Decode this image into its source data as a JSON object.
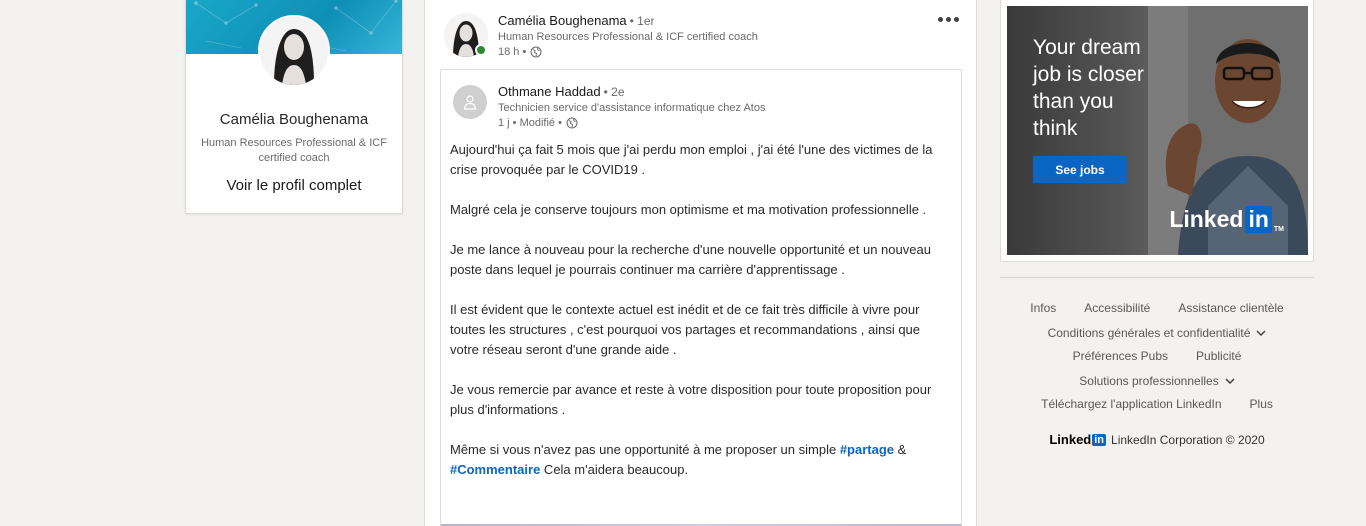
{
  "profile": {
    "name": "Camélia Boughenama",
    "headline": "Human Resources Professional & ICF certified coach",
    "view_profile_link": "Voir le profil complet"
  },
  "post": {
    "author": "Camélia Boughenama",
    "degree": "• 1er",
    "headline": "Human Resources Professional & ICF certified coach",
    "time": "18 h •"
  },
  "shared": {
    "author": "Othmane Haddad",
    "degree": "• 2e",
    "headline": "Technicien service d'assistance informatique chez Atos",
    "time": "1 j • Modifié •",
    "paragraphs": [
      "Aujourd'hui ça fait 5 mois que j'ai perdu mon emploi , j'ai été l'une des victimes de la crise provoquée par le COVID19 .",
      "Malgré cela je conserve toujours mon optimisme et ma motivation professionnelle .",
      "Je me lance à nouveau pour la recherche d'une nouvelle opportunité et un nouveau poste dans lequel je pourrais continuer ma carrière d'apprentissage .",
      "Il est évident que le contexte actuel est inédit et de ce fait très difficile à vivre pour toutes les structures , c'est pourquoi vos partages et recommandations , ainsi que votre réseau seront d'une grande aide .",
      "Je vous remercie par avance et reste à votre disposition pour toute proposition pour plus d'informations ."
    ],
    "last_paragraph_prefix": "Même si vous n'avez pas une opportunité à me proposer un simple ",
    "hashtag_1": "#partage",
    "between_hashtags": " & ",
    "hashtag_2": "#Commentaire",
    "last_paragraph_suffix": " Cela m'aidera beaucoup."
  },
  "ad": {
    "headline": "Your dream job is closer than you think",
    "button": "See jobs",
    "logo_text": "Linked",
    "logo_in": "in",
    "logo_tm": "TM"
  },
  "footer": {
    "links": {
      "infos": "Infos",
      "accessibilite": "Accessibilité",
      "assistance": "Assistance clientèle",
      "conditions": "Conditions générales et confidentialité",
      "preferences": "Préférences Pubs",
      "publicite": "Publicité",
      "solutions": "Solutions professionnelles",
      "app": "Téléchargez l'application LinkedIn",
      "plus": "Plus"
    },
    "brand_logo_text": "Linked",
    "brand_logo_in": "in",
    "copyright": "LinkedIn Corporation © 2020"
  },
  "colors": {
    "accent": "#0a66c2",
    "online": "#2d8a2f",
    "background": "#f3f2ef"
  }
}
